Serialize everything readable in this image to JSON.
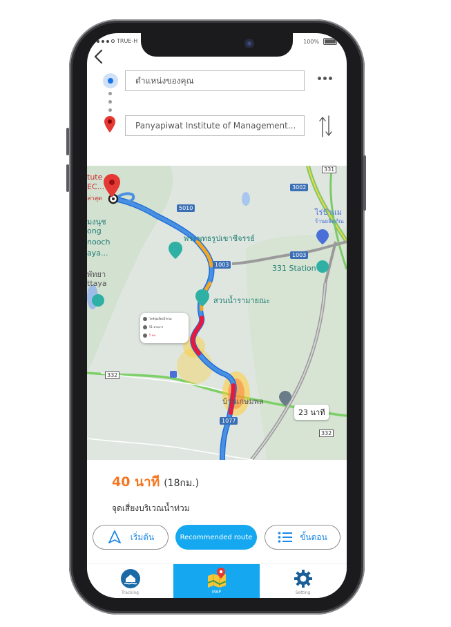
{
  "status": {
    "carrier": "TRUE-H",
    "battery": "100%"
  },
  "search": {
    "origin_placeholder": "ตำแหน่งของคุณ",
    "destination_value": "Panyapiwat Institute of Management..."
  },
  "map": {
    "place_1": "พระพุทธรูปเขาชีจรรย์",
    "place_2": "สวนน้ำรามายณะ",
    "place_3": "331 Station",
    "place_4": "บ้านเกษมพล",
    "place_5": "ไร่ป้าแม",
    "place_5b": "ร้านผลิตภัณ",
    "edge_top_1": "tute",
    "edge_top_2": "EC...",
    "edge_top_3": "ล่าสุด",
    "edge_left_1": "มงนุช",
    "edge_left_2": "ong",
    "edge_left_3": "nooch",
    "edge_left_4": "aya...",
    "edge_left_5": "พัทยา",
    "edge_left_6": "ttaya",
    "road_5010": "5010",
    "road_1003a": "1003",
    "road_1003b": "1003",
    "road_3002": "3002",
    "road_331": "331",
    "road_332a": "332",
    "road_332b": "332",
    "road_1077": "1077",
    "route_time": "23 นาที",
    "popup_line1": "ไลท์จุดเสี่ยงน้ำท่วม",
    "popup_line2": "51 ทางดาว",
    "popup_line3": "5 คน",
    "popup_label": "ไลท์",
    "route_color": "#4a90e2",
    "traffic_slow": "#f5a623",
    "hazard_color": "#e8193c"
  },
  "route_info": {
    "eta_time": "40 นาที",
    "eta_distance": "(18กม.)",
    "warning": "จุดเสี่ยงบริเวณน้ำท่วม"
  },
  "actions": {
    "start": "เริ่มต้น",
    "recommended": "Recommended route",
    "steps": "ขั้นตอน"
  },
  "tabs": [
    {
      "label": "Tracking",
      "icon": "home-flood-icon"
    },
    {
      "label": "MAP",
      "icon": "map-icon"
    },
    {
      "label": "Setting",
      "icon": "gear-icon"
    }
  ],
  "colors": {
    "accent": "#15a8f0",
    "eta": "#f37722",
    "link": "#1d88e5"
  }
}
